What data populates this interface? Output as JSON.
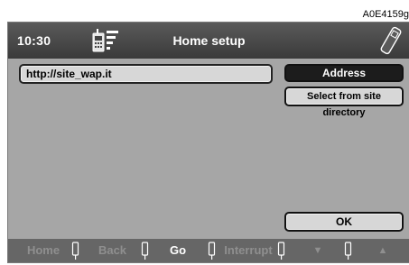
{
  "figure_code": "A0E4159g",
  "titlebar": {
    "time": "10:30",
    "title": "Home setup",
    "left_icon": "phone-wap-icon",
    "right_icon": "handset-icon"
  },
  "url_field": {
    "value": "http://site_wap.it"
  },
  "buttons": {
    "address": "Address",
    "select_directory": "Select from site directory",
    "ok": "OK"
  },
  "softkeys": {
    "home": "Home",
    "back": "Back",
    "go": "Go",
    "interrupt": "Interrupt",
    "down": "▼",
    "up": "▲"
  },
  "colors": {
    "screen_bg": "#a6a6a6",
    "titlebar_bg": "#444444",
    "selected_button_bg": "#1c1c1c",
    "softbar_bg": "#666666"
  }
}
